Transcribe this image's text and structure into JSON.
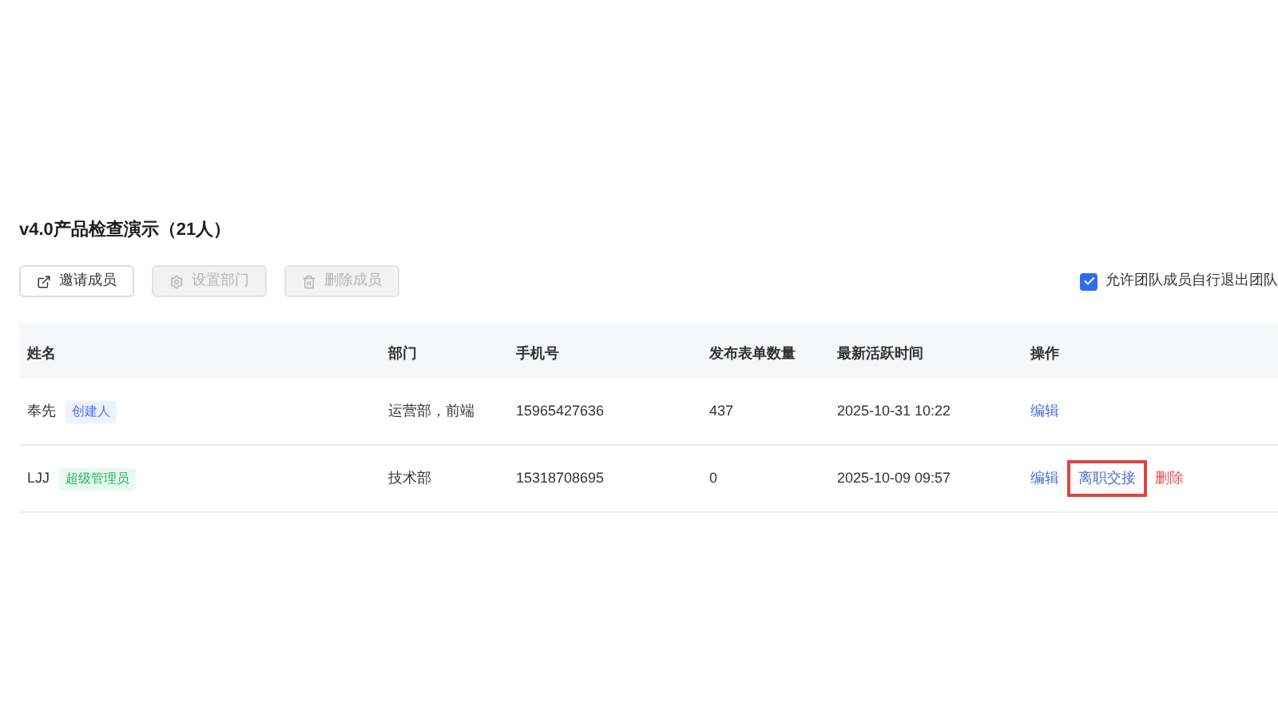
{
  "title": "v4.0产品检查演示（21人）",
  "toolbar": [
    {
      "label": "邀请成员",
      "kind": "invite",
      "disabled": false
    },
    {
      "label": "设置部门",
      "kind": "settings",
      "disabled": true
    },
    {
      "label": "删除成员",
      "kind": "delete",
      "disabled": true
    }
  ],
  "allow_exit": {
    "label": "允许团队成员自行退出团队",
    "checked": true
  },
  "table": {
    "columns": [
      "姓名",
      "部门",
      "手机号",
      "发布表单数量",
      "最新活跃时间",
      "操作"
    ],
    "rows": [
      {
        "name": "奉先",
        "role": {
          "label": "创建人",
          "kind": "creator"
        },
        "department": "运营部，前端",
        "phone": "15965427636",
        "forms": "437",
        "last_active": "2025-10-31 10:22",
        "actions": [
          {
            "label": "编辑",
            "kind": "primary",
            "highlighted": false
          }
        ]
      },
      {
        "name": "LJJ",
        "role": {
          "label": "超级管理员",
          "kind": "admin"
        },
        "department": "技术部",
        "phone": "15318708695",
        "forms": "0",
        "last_active": "2025-10-09 09:57",
        "actions": [
          {
            "label": "编辑",
            "kind": "primary",
            "highlighted": false
          },
          {
            "label": "离职交接",
            "kind": "primary",
            "highlighted": true
          },
          {
            "label": "删除",
            "kind": "danger",
            "highlighted": false
          }
        ]
      }
    ]
  }
}
